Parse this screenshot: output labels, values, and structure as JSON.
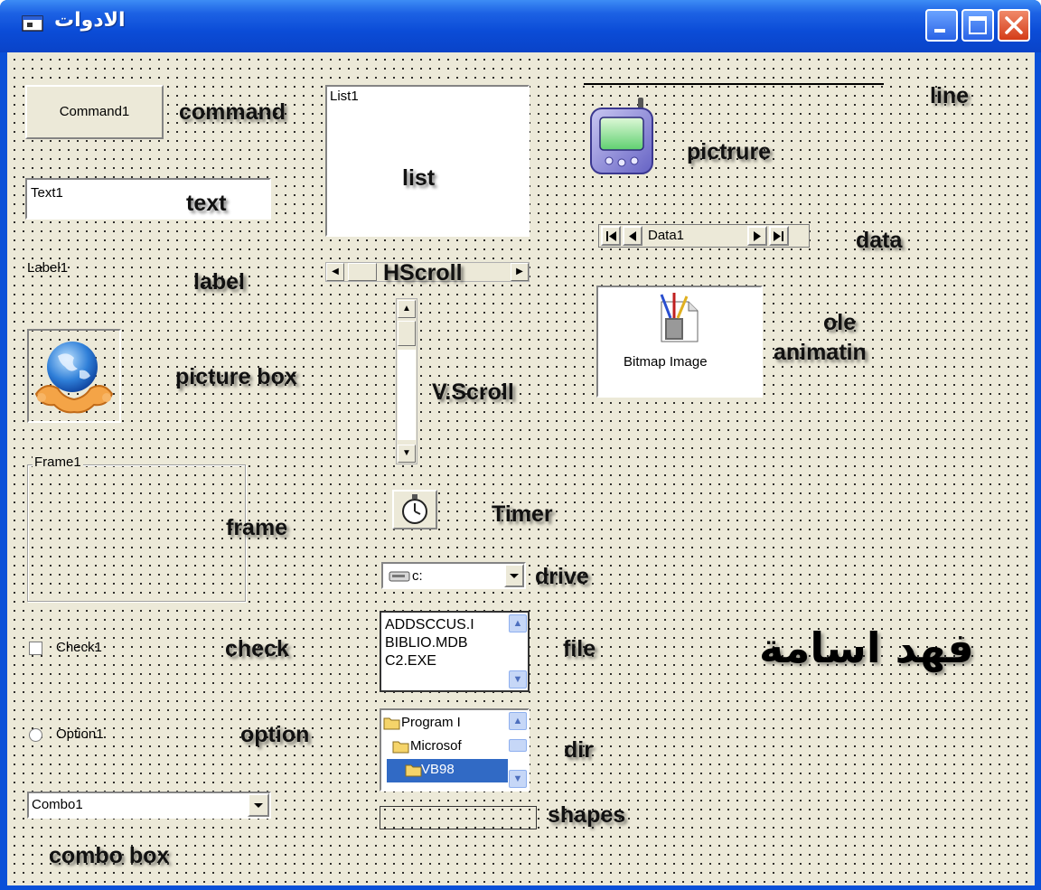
{
  "window": {
    "title": "الادوات",
    "minimize_icon": "minimize-icon",
    "maximize_icon": "maximize-icon",
    "close_icon": "close-icon"
  },
  "controls": {
    "command": {
      "label": "Command1"
    },
    "text": {
      "value": "Text1"
    },
    "label": {
      "text": "Label1"
    },
    "frame": {
      "caption": "Frame1"
    },
    "check": {
      "label": "Check1"
    },
    "option": {
      "label": "Option1"
    },
    "combo": {
      "value": "Combo1"
    },
    "list": {
      "first_item": "List1"
    },
    "hscroll_label": "HScroll",
    "data": {
      "caption": "Data1"
    },
    "ole": {
      "caption": "Bitmap Image"
    },
    "drive": {
      "value": "c:"
    },
    "file": {
      "items": [
        "ADDSCCUS.I",
        "BIBLIO.MDB",
        "C2.EXE"
      ]
    },
    "dir": {
      "items": [
        "Program I",
        "Microsof",
        "VB98"
      ]
    }
  },
  "captions": {
    "command": "command",
    "text": "text",
    "label": "label",
    "picture_box": "picture box",
    "frame": "frame",
    "check": "check",
    "option": "option",
    "combo_box": "combo box",
    "list": "list",
    "vscroll": "V.Scroll",
    "timer": "Timer",
    "drive": "drive",
    "file": "file",
    "dir": "dir",
    "shapes": "shapes",
    "line": "line",
    "picture": "pictrure",
    "data": "data",
    "ole_1": "ole",
    "ole_2": "animatin",
    "author": "فهد اسامة"
  }
}
